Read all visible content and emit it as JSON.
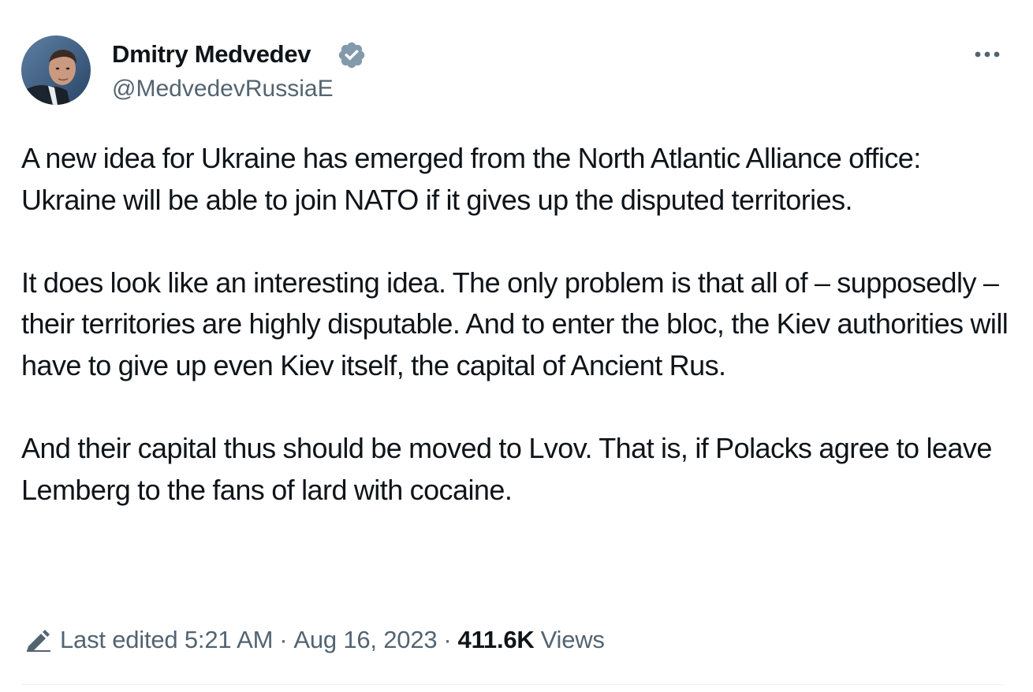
{
  "author": {
    "name": "Dmitry Medvedev",
    "handle": "@MedvedevRussiaE",
    "verified": true,
    "verified_color": "#829aab"
  },
  "tweet": {
    "paragraphs": [
      "A new idea for Ukraine has emerged from the North Atlantic Alliance office: Ukraine will be able to join NATO if it gives up the disputed territories.",
      "It does look like an interesting idea. The only problem is that all of – supposedly – their territories are highly disputable. And to enter the bloc, the Kiev authorities will have to give up even Kiev itself, the capital of Ancient Rus.",
      "And their capital thus should be moved to Lvov. That is, if Polacks agree to leave Lemberg to the fans of lard with cocaine."
    ]
  },
  "meta": {
    "edited_label": "Last edited 5:21 AM",
    "date": "Aug 16, 2023",
    "views_count": "411.6K",
    "views_label": "Views",
    "separator": "·"
  },
  "icons": {
    "more": "more-dots-icon",
    "verified": "verified-badge-icon",
    "edit": "pencil-icon"
  },
  "colors": {
    "text": "#0f1419",
    "secondary": "#536471",
    "divider": "#eff3f4"
  }
}
